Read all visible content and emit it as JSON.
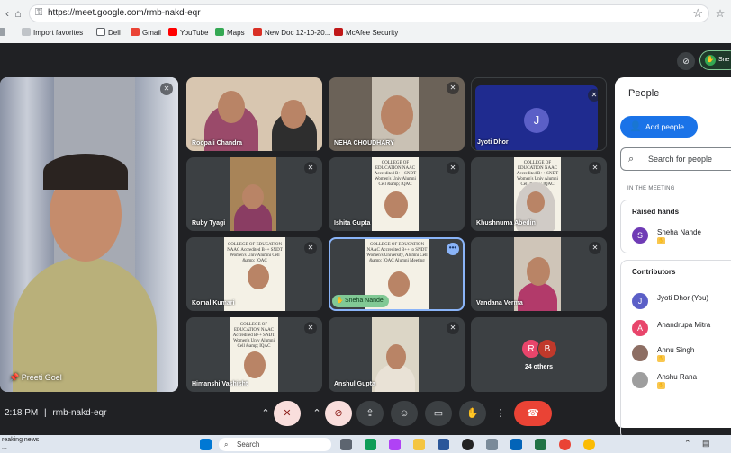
{
  "browser": {
    "url": "https://meet.google.com/rmb-nakd-eqr",
    "bookmarks": [
      "Import favorites",
      "Dell",
      "Gmail",
      "YouTube",
      "Maps",
      "New Doc 12-10-20...",
      "McAfee Security"
    ]
  },
  "meet": {
    "top_right_label": "Sne",
    "main_speaker": "Preeti Goel",
    "tiles": [
      {
        "name": "Roopali Chandra"
      },
      {
        "name": "NEHA CHOUDHARY"
      },
      {
        "name": "Jyoti Dhor",
        "avatar": "J"
      },
      {
        "name": "Ruby Tyagi"
      },
      {
        "name": "Ishita Gupta"
      },
      {
        "name": "Khushnuma Abedin"
      },
      {
        "name": "Komal Kumari"
      },
      {
        "name": "Sneha Nande"
      },
      {
        "name": "Vandana Verma"
      },
      {
        "name": "Himanshi Vashisht"
      },
      {
        "name": "Anshul Gupta"
      },
      {
        "name": "24 others",
        "avatars": [
          "R",
          "B"
        ]
      }
    ],
    "banner_text": {
      "a": "COLLEGE OF EDUCATION NAAC Accredited B++ SNDT Women's Univ Alumni Cell &amp; IQAC",
      "b": "COLLEGE OF EDUCATION NAAC Accredited B++ to SNDT Women's University, Alumni Cell &amp; IQAC Alumni Meeting"
    }
  },
  "people_panel": {
    "title": "People",
    "add_people": "Add people",
    "search_placeholder": "Search for people",
    "section": "IN THE MEETING",
    "raised_hands": {
      "header": "Raised hands",
      "people": [
        {
          "initial": "S",
          "name": "Sneha Nande",
          "color": "#6f3bb5"
        }
      ]
    },
    "contributors": {
      "header": "Contributors",
      "people": [
        {
          "initial": "J",
          "name": "Jyoti Dhor (You)",
          "color": "#5b5fc7"
        },
        {
          "initial": "A",
          "name": "Anandrupa Mitra",
          "color": "#e8456b"
        },
        {
          "initial": "",
          "name": "Annu Singh",
          "color": "#8d6e63"
        },
        {
          "initial": "",
          "name": "Anshu Rana",
          "color": "#9e9e9e"
        }
      ]
    }
  },
  "toolbar": {
    "time": "2:18 PM",
    "separator": "|",
    "meeting_code": "rmb-nakd-eqr"
  },
  "taskbar": {
    "news": "reaking news",
    "news2": "...",
    "search": "Search"
  },
  "colors": {
    "accent": "#1a73e8",
    "end_call": "#ea4335",
    "mic_off": "#f9dedc"
  }
}
